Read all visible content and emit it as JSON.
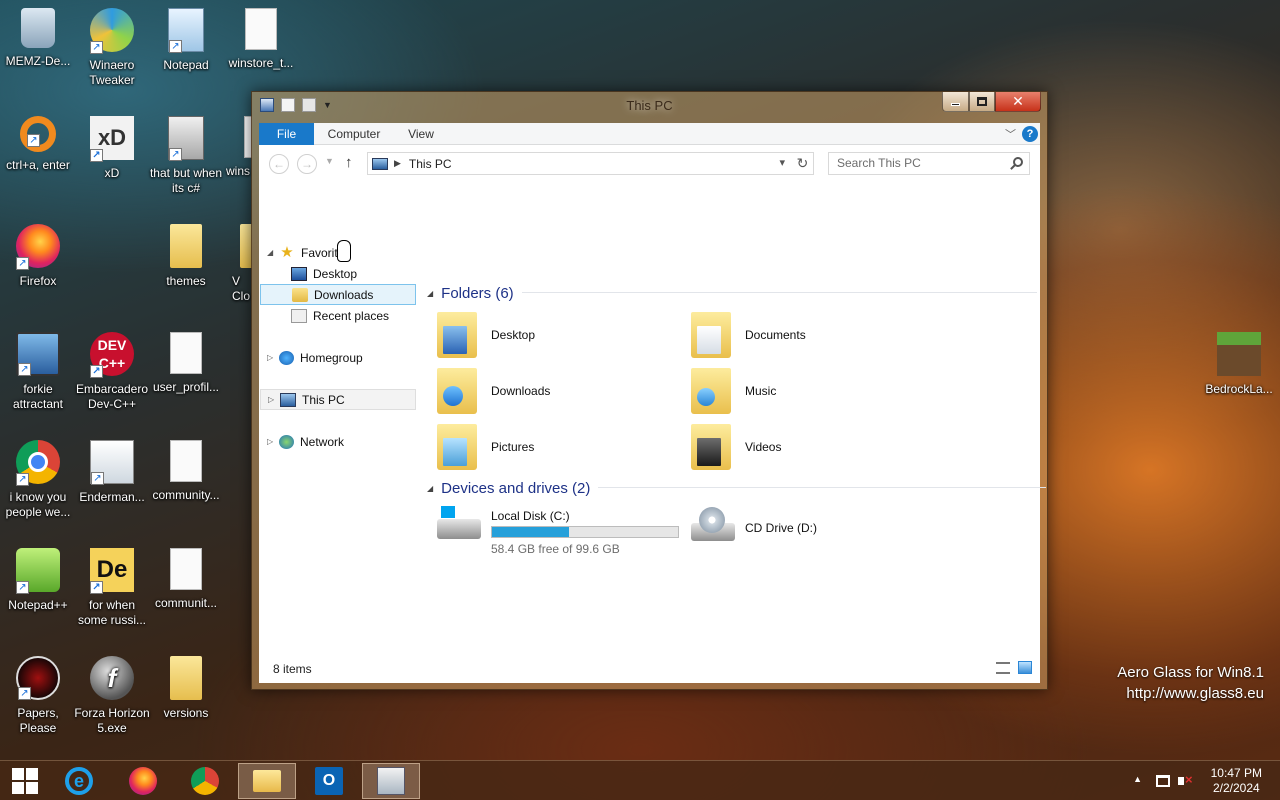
{
  "desktop": {
    "icons": [
      {
        "label": "MEMZ-De...",
        "icon": "recycle-bin-icon"
      },
      {
        "label": "Winaero Tweaker",
        "icon": "winaero-icon"
      },
      {
        "label": "Notepad",
        "icon": "notepad-icon"
      },
      {
        "label": "winstore_t...",
        "icon": "file-icon"
      },
      {
        "label": "ctrl+a, enter",
        "icon": "orange-ring-icon"
      },
      {
        "label": "xD",
        "icon": "xd-icon"
      },
      {
        "label": "that but when its c#",
        "icon": "windows-stack-icon"
      },
      {
        "label": "wins",
        "icon": "file-icon"
      },
      {
        "label": "Firefox",
        "icon": "firefox-icon"
      },
      {
        "label": "themes",
        "icon": "folder-icon"
      },
      {
        "label": "V Clo",
        "icon": "app-icon"
      },
      {
        "label": "forkie attractant",
        "icon": "monitor-gear-icon"
      },
      {
        "label": "Embarcadero Dev-C++",
        "icon": "devcpp-icon"
      },
      {
        "label": "user_profil...",
        "icon": "file-icon"
      },
      {
        "label": "i know you people we...",
        "icon": "chrome-icon"
      },
      {
        "label": "Enderman...",
        "icon": "document-window-icon"
      },
      {
        "label": "community...",
        "icon": "file-icon"
      },
      {
        "label": "Notepad++",
        "icon": "notepad-plus-plus-icon"
      },
      {
        "label": "for when some russi...",
        "icon": "de-icon"
      },
      {
        "label": "communit...",
        "icon": "file-icon"
      },
      {
        "label": "Papers, Please",
        "icon": "papers-please-icon"
      },
      {
        "label": "Forza Horizon 5.exe",
        "icon": "flash-icon"
      },
      {
        "label": "versions",
        "icon": "folder-icon"
      },
      {
        "label": "BedrockLa...",
        "icon": "minecraft-icon"
      }
    ]
  },
  "window": {
    "title": "This PC",
    "close_glyph": "✕"
  },
  "ribbon": {
    "tabs": [
      "File",
      "Computer",
      "View"
    ],
    "help": "?"
  },
  "nav": {
    "back": "←",
    "forward": "→",
    "up": "↑",
    "address": "This PC",
    "address_sep": "▶",
    "refresh": "↻",
    "search_placeholder": "Search This PC"
  },
  "navpane": {
    "favorites": "Favorites",
    "desktop": "Desktop",
    "downloads": "Downloads",
    "recent_places": "Recent places",
    "homegroup": "Homegroup",
    "this_pc": "This PC",
    "network": "Network"
  },
  "content": {
    "folders_header": "Folders (6)",
    "folders": [
      "Desktop",
      "Documents",
      "Downloads",
      "Music",
      "Pictures",
      "Videos"
    ],
    "devices_header": "Devices and drives (2)",
    "drives": [
      {
        "name": "Local Disk (C:)",
        "free": "58.4 GB free of 99.6 GB",
        "used_fraction": 0.414
      },
      {
        "name": "CD Drive (D:)"
      }
    ]
  },
  "status": {
    "items": "8 items"
  },
  "watermark": {
    "line1": "Aero Glass for Win8.1",
    "line2": "http://www.glass8.eu"
  },
  "taskbar": {
    "clock_time": "10:47 PM",
    "clock_date": "2/2/2024",
    "tray_up": "▲"
  },
  "colors": {
    "file_tab": "#1979ca",
    "group_header": "#1e3287",
    "drive_bar": "#26a0da",
    "selection": "#e5f3fb"
  }
}
